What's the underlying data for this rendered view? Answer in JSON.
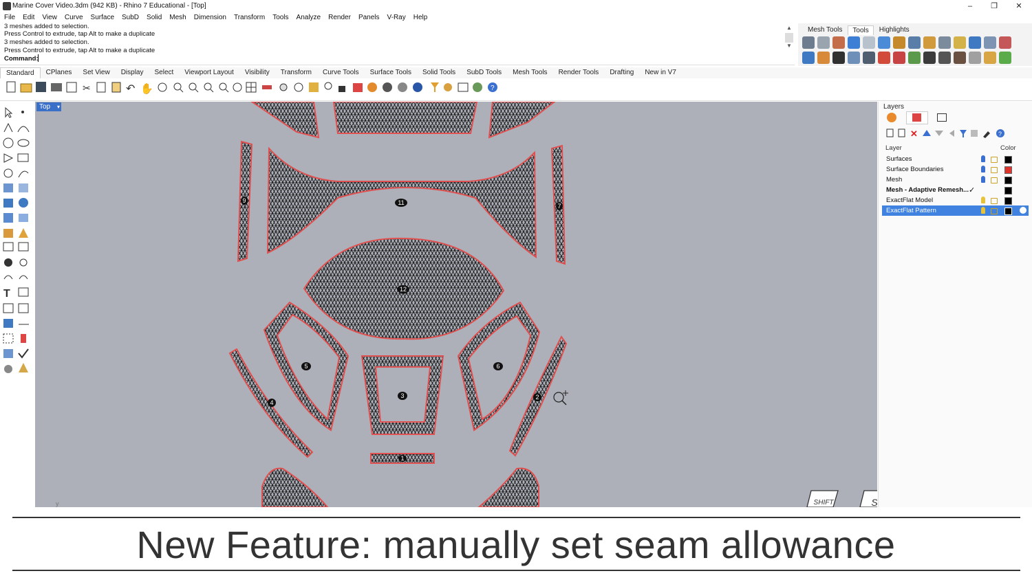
{
  "window": {
    "title": "Marine Cover Video.3dm (942 KB) - Rhino 7 Educational - [Top]",
    "minimize": "–",
    "maximize": "❐",
    "close": "✕"
  },
  "menu": [
    "File",
    "Edit",
    "View",
    "Curve",
    "Surface",
    "SubD",
    "Solid",
    "Mesh",
    "Dimension",
    "Transform",
    "Tools",
    "Analyze",
    "Render",
    "Panels",
    "V-Ray",
    "Help"
  ],
  "command_history": [
    "3 meshes added to selection.",
    "Press Control to extrude, tap Alt to make a duplicate",
    "3 meshes added to selection.",
    "Press Control to extrude, tap Alt to make a duplicate"
  ],
  "command_prompt": "Command:",
  "side_tabs": [
    "Mesh Tools",
    "Tools",
    "Highlights"
  ],
  "toolbar_tabs": [
    "Standard",
    "CPlanes",
    "Set View",
    "Display",
    "Select",
    "Viewport Layout",
    "Visibility",
    "Transform",
    "Curve Tools",
    "Surface Tools",
    "Solid Tools",
    "SubD Tools",
    "Mesh Tools",
    "Render Tools",
    "Drafting",
    "New in V7"
  ],
  "viewport": {
    "name": "Top",
    "axis_label": "y",
    "piece_labels": [
      "11",
      "12",
      "9",
      "7",
      "5",
      "6",
      "3",
      "4",
      "2",
      "1"
    ]
  },
  "keys": {
    "shift": "SHIFT",
    "s": "S"
  },
  "layers": {
    "title": "Layers",
    "col_layer": "Layer",
    "col_color": "Color",
    "rows": [
      {
        "name": "Surfaces",
        "color": "#000000"
      },
      {
        "name": "Surface Boundaries",
        "color": "#e0332c"
      },
      {
        "name": "Mesh",
        "color": "#000000"
      },
      {
        "name": "Mesh - Adaptive Remesh...",
        "color": "#000000"
      },
      {
        "name": "ExactFlat Model",
        "color": "#000000"
      },
      {
        "name": "ExactFlat Pattern",
        "color": "#000000"
      }
    ],
    "current_mark": "✓"
  },
  "caption": "New Feature: manually set seam allowance",
  "colors": {
    "accent": "#3b70c8",
    "selection": "#3f82df",
    "mesh_outline": "#e35050",
    "viewport_bg": "#adb0b8"
  }
}
